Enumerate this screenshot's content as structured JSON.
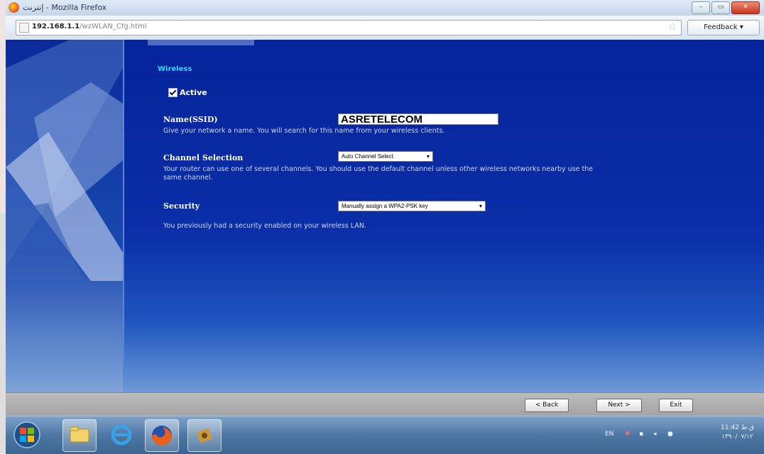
{
  "window": {
    "title": "إنترنت - Mozilla Firefox"
  },
  "navbar": {
    "url_host": "192.168.1.1",
    "url_path": "/wzWLAN_Cfg.html",
    "feedback_label": "Feedback"
  },
  "page": {
    "wireless_link": "Wireless",
    "active_label": "Active",
    "ssid": {
      "label": "Name(SSID)",
      "value": "ASRETELECOM",
      "help": "Give your network a name. You will search for this name from your wireless clients."
    },
    "channel": {
      "label": "Channel Selection",
      "selected": "Auto Channel Select",
      "help_line1": "Your router can use one of several channels. You should use the default channel unless other wireless networks nearby use the",
      "help_line2": "same channel."
    },
    "security": {
      "label": "Security",
      "selected": "Manually assign a WPA2-PSK key",
      "help": "You previously had a security enabled on your wireless LAN."
    }
  },
  "buttons": {
    "back": "< Back",
    "next": "Next >",
    "exit": "Exit"
  },
  "taskbar": {
    "items": [
      "start-orb",
      "windows-explorer",
      "internet-explorer",
      "firefox",
      "app"
    ],
    "lang": "EN",
    "clock_time": "11:42 ق.ظ",
    "clock_date": "١٣٩٠/٠٧/١٢"
  }
}
